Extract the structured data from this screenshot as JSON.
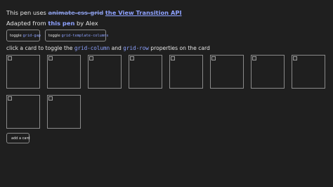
{
  "intro": {
    "prefix": "This pen uses ",
    "struck_text": "animate-css-grid",
    "link_text": "the View Transition API"
  },
  "credit": {
    "prefix": "Adapted from ",
    "link_text": "this pen",
    "suffix": " by Alex"
  },
  "buttons": {
    "gap_prefix": "toggle ",
    "gap_code": "grid-gap",
    "columns_prefix": "toggle ",
    "columns_code": "grid-template-columns",
    "add_card": "add a card"
  },
  "instructions": {
    "prefix": "click a card to toggle the ",
    "code1": "grid-column",
    "middle": " and ",
    "code2": "grid-row",
    "suffix": " properties on the card"
  },
  "cards": [
    {
      "icon": "broken-image-icon"
    },
    {
      "icon": "broken-image-icon"
    },
    {
      "icon": "broken-image-icon"
    },
    {
      "icon": "broken-image-icon"
    },
    {
      "icon": "broken-image-icon"
    },
    {
      "icon": "broken-image-icon"
    },
    {
      "icon": "broken-image-icon"
    },
    {
      "icon": "broken-image-icon"
    },
    {
      "icon": "broken-image-icon"
    }
  ],
  "colors": {
    "background": "#1f1f1f",
    "text": "#e6e6e6",
    "link": "#8ea2ff",
    "border": "#8a8a8a"
  }
}
